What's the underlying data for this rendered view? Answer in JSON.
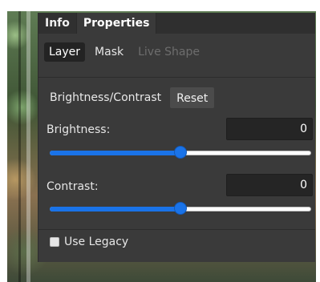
{
  "panel": {
    "tabs": [
      {
        "label": "Info"
      },
      {
        "label": "Properties"
      }
    ],
    "subtabs": [
      {
        "label": "Layer"
      },
      {
        "label": "Mask"
      },
      {
        "label": "Live Shape"
      }
    ],
    "adjustment": {
      "title": "Brightness/Contrast",
      "reset_label": "Reset"
    },
    "brightness": {
      "label": "Brightness:",
      "value": "0",
      "slider_level": 0.5
    },
    "contrast": {
      "label": "Contrast:",
      "value": "0",
      "slider_level": 0.5
    },
    "use_legacy": {
      "label": "Use Legacy",
      "checked": false
    }
  },
  "colors": {
    "panel_bg": "#3a3a3a",
    "accent": "#1a73e8",
    "text": "#e6e6e6"
  }
}
